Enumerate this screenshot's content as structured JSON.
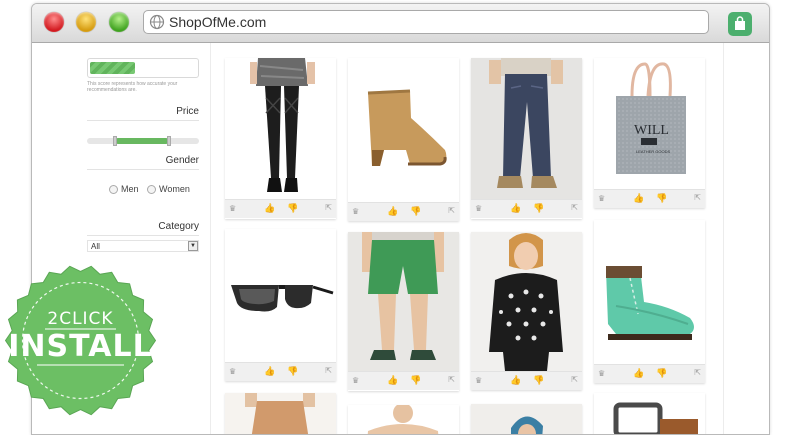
{
  "browser": {
    "url": "ShopOfMe.com"
  },
  "sidebar": {
    "score_note": "This score represents how accurate your recommendations are.",
    "score_fraction": 0.42,
    "price_label": "Price",
    "gender_label": "Gender",
    "gender_options": [
      "Men",
      "Women"
    ],
    "category_label": "Category",
    "category_value": "All"
  },
  "badge": {
    "line1": "2CLICK",
    "line2": "INSTALL",
    "color": "#6cbf64"
  },
  "products": [
    {
      "name": "skirt-tights-outfit"
    },
    {
      "name": "tan-wedge-boots"
    },
    {
      "name": "dark-jeans-man"
    },
    {
      "name": "grey-tote-bag"
    },
    {
      "name": "black-sunglasses"
    },
    {
      "name": "green-shorts-man"
    },
    {
      "name": "black-dotted-sweater"
    },
    {
      "name": "mint-hiking-boots"
    }
  ],
  "colors": {
    "accent_green": "#68b860",
    "ext_icon": "#4caf6e"
  }
}
